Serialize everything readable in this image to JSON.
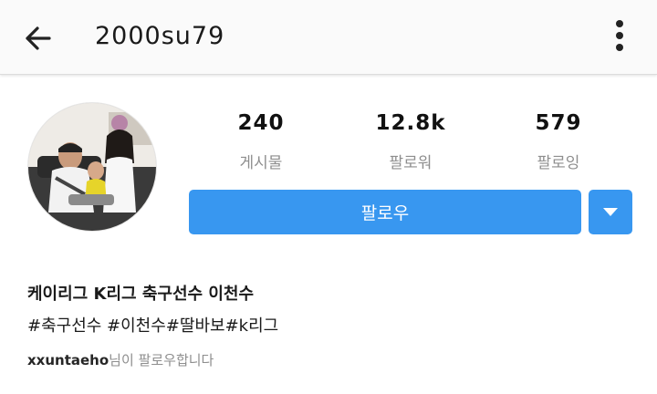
{
  "header": {
    "back_icon": "arrow-left-icon",
    "username": "2000su79",
    "more_icon": "more-vertical-icon"
  },
  "stats": [
    {
      "value": "240",
      "label": "게시물"
    },
    {
      "value": "12.8k",
      "label": "팔로워"
    },
    {
      "value": "579",
      "label": "팔로잉"
    }
  ],
  "actions": {
    "follow_label": "팔로우",
    "dropdown_icon": "caret-down-icon"
  },
  "bio": {
    "name_line": "케이리그 K리그 축구선수 이천수",
    "hashtags": "#축구선수 #이천수#딸바보#k리그",
    "followed_by_user": "xxuntaeho",
    "followed_by_suffix": "님이 팔로우합니다"
  },
  "colors": {
    "accent": "#3897f0",
    "muted": "#8e8e8e",
    "text": "#262626"
  }
}
